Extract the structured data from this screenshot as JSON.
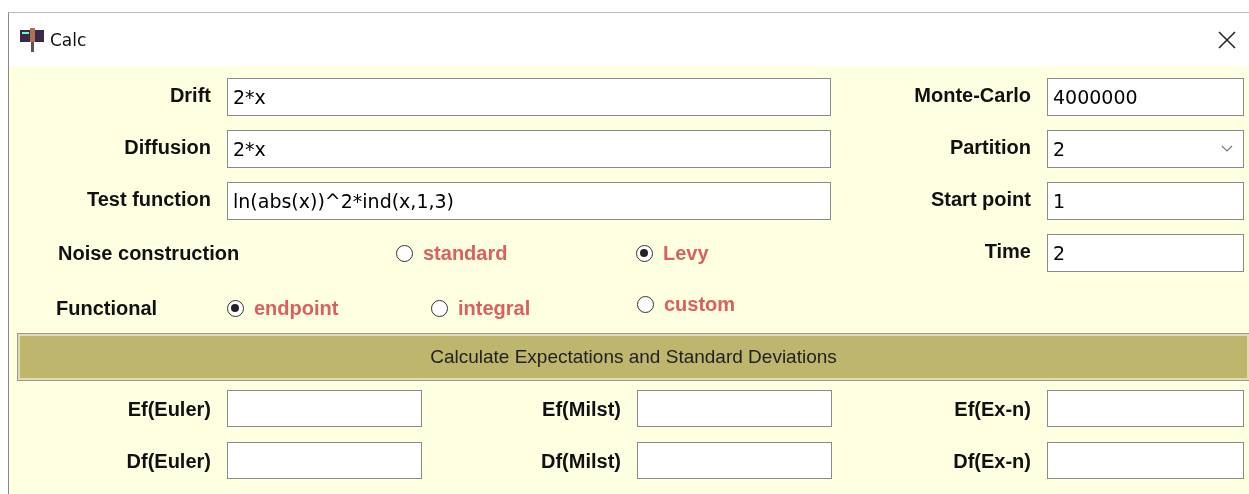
{
  "window": {
    "title": "Calc"
  },
  "left_fields": [
    {
      "label": "Drift",
      "value": "2*x"
    },
    {
      "label": "Diffusion",
      "value": "2*x"
    },
    {
      "label": "Test function",
      "value": "ln(abs(x))^2*ind(x,1,3)"
    }
  ],
  "right_fields": [
    {
      "label": "Monte-Carlo",
      "value": "4000000",
      "kind": "text"
    },
    {
      "label": "Partition",
      "value": "2",
      "kind": "dropdown"
    },
    {
      "label": "Start point",
      "value": "1",
      "kind": "text"
    },
    {
      "label": "Time",
      "value": "2",
      "kind": "text"
    }
  ],
  "noise_construction": {
    "label": "Noise construction",
    "options": [
      {
        "label": "standard",
        "selected": false
      },
      {
        "label": "Levy",
        "selected": true
      }
    ]
  },
  "functional": {
    "label": "Functional",
    "options": [
      {
        "label": "endpoint",
        "selected": true
      },
      {
        "label": "integral",
        "selected": false
      },
      {
        "label": "custom",
        "selected": false
      }
    ]
  },
  "calculate_button": "Calculate Expectations and Standard Deviations",
  "results": [
    {
      "label": "Ef(Euler)"
    },
    {
      "label": "Ef(Milst)"
    },
    {
      "label": "Ef(Ex-n)"
    },
    {
      "label": "Df(Euler)"
    },
    {
      "label": "Df(Milst)"
    },
    {
      "label": "Df(Ex-n)"
    }
  ]
}
